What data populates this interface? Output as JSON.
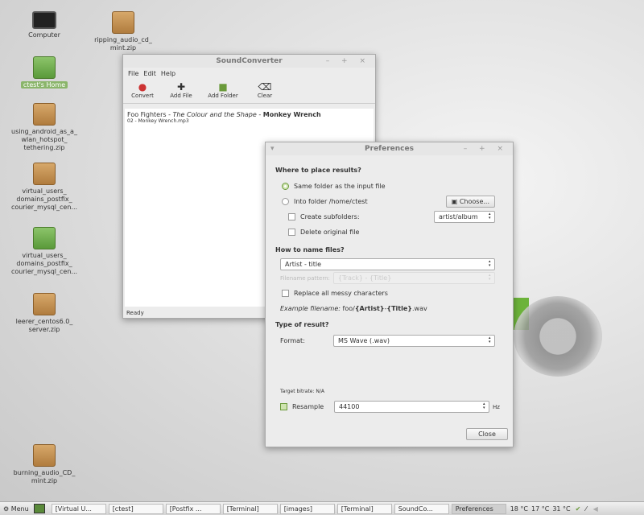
{
  "desktop": [
    {
      "label": "Computer",
      "kind": "monitor"
    },
    {
      "label": "ripping_audio_cd_ mint.zip",
      "kind": "box"
    },
    {
      "label": "ctest's Home",
      "kind": "folder"
    },
    {
      "label": "using_android_as_a_ wlan_hotspot_ tethering.zip",
      "kind": "box"
    },
    {
      "label": "virtual_users_ domains_postfix_ courier_mysql_cen...",
      "kind": "box"
    },
    {
      "label": "virtual_users_ domains_postfix_ courier_mysql_cen...",
      "kind": "folder"
    },
    {
      "label": "leerer_centos6.0_ server.zip",
      "kind": "box"
    },
    {
      "label": "burning_audio_CD_ mint.zip",
      "kind": "box"
    }
  ],
  "sc": {
    "title": "SoundConverter",
    "menu": [
      "File",
      "Edit",
      "Help"
    ],
    "toolbar": [
      "Convert",
      "Add File",
      "Add Folder",
      "Clear"
    ],
    "file": {
      "artist": "Foo Fighters",
      "sep": " - ",
      "album": "The Colour and the Shape",
      "title": "Monkey Wrench",
      "filename": "02 - Monkey Wrench.mp3"
    },
    "status": "Ready"
  },
  "prefs": {
    "title": "Preferences",
    "where": "Where to place results?",
    "same": "Same folder as the input file",
    "into": "Into folder /home/ctest",
    "choose": "Choose...",
    "subfolders": "Create subfolders:",
    "subfolder_value": "artist/album",
    "delete": "Delete original file",
    "how": "How to name files?",
    "naming": "Artist - title",
    "pattern_label": "Filename pattern:",
    "pattern_value": "{Track} - {Title}",
    "messy": "Replace all messy characters",
    "example_prefix": "Example filename: ",
    "example_path": "foo/",
    "example_artist": "{Artist}",
    "example_dash": "-",
    "example_title": "{Title}",
    "example_ext": ".wav",
    "type": "Type of result?",
    "format_label": "Format:",
    "format": "MS Wave (.wav)",
    "bitrate": "Target bitrate: N/A",
    "resample": "Resample",
    "resample_value": "44100",
    "hz": "Hz",
    "close": "Close"
  },
  "taskbar": {
    "menu": "Menu",
    "items": [
      "[Virtual U...",
      "[ctest]",
      "[Postfix ...",
      "[Terminal]",
      "[images]",
      "[Terminal]",
      "SoundCo...",
      "Preferences"
    ],
    "temps": [
      "18 °C",
      "17 °C",
      "31 °C"
    ]
  }
}
